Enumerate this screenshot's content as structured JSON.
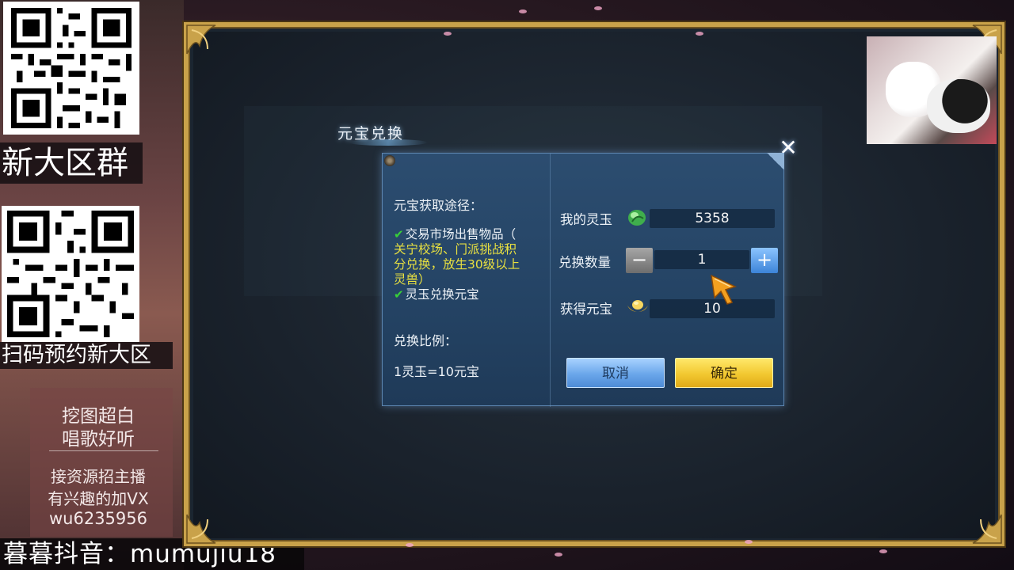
{
  "overlay": {
    "new_zone_group": "新大区群",
    "scan_reserve": "扫码预约新大区",
    "promo": {
      "line1": "挖图超白",
      "line2": "唱歌好听",
      "line3": "接资源招主播",
      "line4": "有兴趣的加VX",
      "line5": "wu6235956"
    },
    "bottom_banner": "暮暮抖音：mumujiu18"
  },
  "window": {
    "title": "元宝兑换",
    "close_symbol": "✕"
  },
  "dialog": {
    "source_title": "元宝获取途径：",
    "source_lines": [
      "交易市场出售物品（",
      "关宁校场、门派挑战积",
      "分兑换，放生30级以上",
      "灵兽）",
      "灵玉兑换元宝"
    ],
    "ratio_title": "兑换比例：",
    "ratio_value": "1灵玉=10元宝",
    "my_jade_label": "我的灵玉",
    "my_jade_value": "5358",
    "exchange_qty_label": "兑换数量",
    "exchange_qty_value": "1",
    "minus_symbol": "−",
    "plus_symbol": "+",
    "obtain_label": "获得元宝",
    "obtain_value": "10",
    "cancel_label": "取消",
    "confirm_label": "确定"
  },
  "icons": {
    "jade": "jade-icon",
    "ingot": "ingot-icon",
    "cursor": "cursor-icon",
    "check": "check-icon"
  },
  "colors": {
    "frame_gold": "#c9a24a",
    "dialog_blue": "#2c4d70",
    "highlight_yellow": "#e8e040",
    "check_green": "#38d038",
    "confirm_gold": "#f2c830",
    "cancel_blue": "#6aa6ea"
  }
}
